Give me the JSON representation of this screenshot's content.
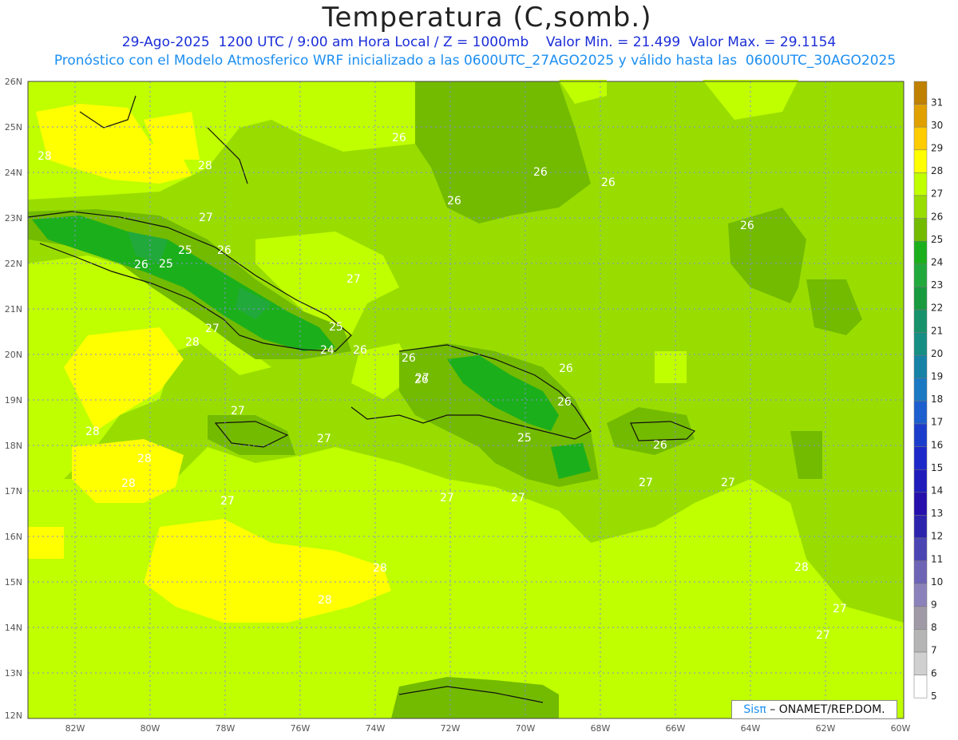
{
  "header": {
    "title": "Temperatura (C,somb.)",
    "line1": "29-Ago-2025  1200 UTC / 9:00 am Hora Local / Z = 1000mb    Valor Min. = 21.499  Valor Max. = 29.1154",
    "line2": "Pronóstico con el Modelo Atmosferico WRF inicializado a las 0600UTC_27AGO2025 y válido hasta las  0600UTC_30AGO2025"
  },
  "axes": {
    "lat_labels": [
      "26N",
      "25N",
      "24N",
      "23N",
      "22N",
      "21N",
      "20N",
      "19N",
      "18N",
      "17N",
      "16N",
      "15N",
      "14N",
      "13N",
      "12N"
    ],
    "lon_labels": [
      "82W",
      "80W",
      "78W",
      "76W",
      "74W",
      "72W",
      "70W",
      "68W",
      "66W",
      "64W",
      "62W",
      "60W"
    ]
  },
  "colorbar": {
    "labels": [
      "31",
      "30",
      "29",
      "28",
      "27",
      "26",
      "25",
      "24",
      "23",
      "22",
      "21",
      "20",
      "19",
      "18",
      "17",
      "16",
      "15",
      "14",
      "13",
      "12",
      "11",
      "10",
      "9",
      "8",
      "7",
      "6",
      "5"
    ],
    "colors": [
      "#c08000",
      "#e0a000",
      "#ffcc00",
      "#ffff00",
      "#c0ff00",
      "#99dd00",
      "#73bb00",
      "#1caf1c",
      "#22a93c",
      "#189a3e",
      "#17926a",
      "#168e83",
      "#1682a6",
      "#1a79c2",
      "#1d5fcf",
      "#1b3dcc",
      "#1d29c8",
      "#1f1cbb",
      "#2510ad",
      "#2d24ae",
      "#4a45b3",
      "#6e64b6",
      "#8c82bb",
      "#a09aa7",
      "#b5b5b5",
      "#d0d0d0",
      "#ffffff"
    ]
  },
  "contour_labels": [
    "26",
    "26",
    "26",
    "26",
    "26",
    "28",
    "28",
    "27",
    "26",
    "25",
    "26",
    "25",
    "27",
    "27",
    "28",
    "25",
    "24",
    "26",
    "26",
    "27",
    "26",
    "26",
    "25",
    "26",
    "26",
    "27",
    "27",
    "28",
    "28",
    "28",
    "27",
    "27",
    "27",
    "27",
    "27",
    "28",
    "28",
    "28",
    "27",
    "27",
    "27",
    "27"
  ],
  "credit": {
    "brand": "Sisπ",
    "rest": " – ONAMET/REP.DOM."
  }
}
